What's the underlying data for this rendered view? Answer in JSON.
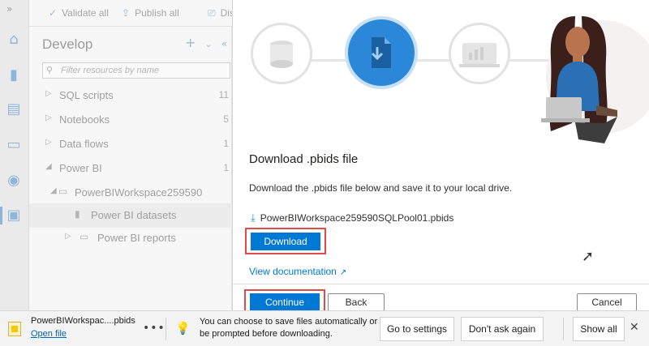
{
  "toolbar": {
    "validate_all": "Validate all",
    "publish_all": "Publish all",
    "discard_truncated": "Disc"
  },
  "rail": {
    "icons": [
      "expand-icon",
      "home-icon",
      "data-icon",
      "develop-icon",
      "integrate-icon",
      "monitor-icon",
      "manage-icon"
    ]
  },
  "develop_panel": {
    "title": "Develop",
    "filter_placeholder": "Filter resources by name",
    "items": [
      {
        "label": "SQL scripts",
        "count": "11"
      },
      {
        "label": "Notebooks",
        "count": "5"
      },
      {
        "label": "Data flows",
        "count": "1"
      },
      {
        "label": "Power BI",
        "count": "1"
      }
    ],
    "workspace": "PowerBIWorkspace259590",
    "datasets": "Power BI datasets",
    "reports": "Power BI reports"
  },
  "dialog": {
    "title": "Download .pbids file",
    "description": "Download the .pbids file below and save it to your local drive.",
    "file_name": "PowerBIWorkspace259590SQLPool01.pbids",
    "download_label": "Download",
    "doc_link": "View documentation",
    "continue_label": "Continue",
    "back_label": "Back",
    "cancel_label": "Cancel",
    "steps": [
      "database-step-icon",
      "download-file-step-icon",
      "report-step-icon"
    ]
  },
  "download_bar": {
    "file_name": "PowerBIWorkspac....pbids",
    "open_file": "Open file",
    "message": "You can choose to save files automatically or be prompted before downloading.",
    "go_to_settings": "Go to settings",
    "dont_ask_again": "Don't ask again",
    "show_all": "Show all"
  },
  "colors": {
    "accent": "#0078d4",
    "highlight_box": "#e04a4a",
    "step_active": "#2b88d8"
  }
}
